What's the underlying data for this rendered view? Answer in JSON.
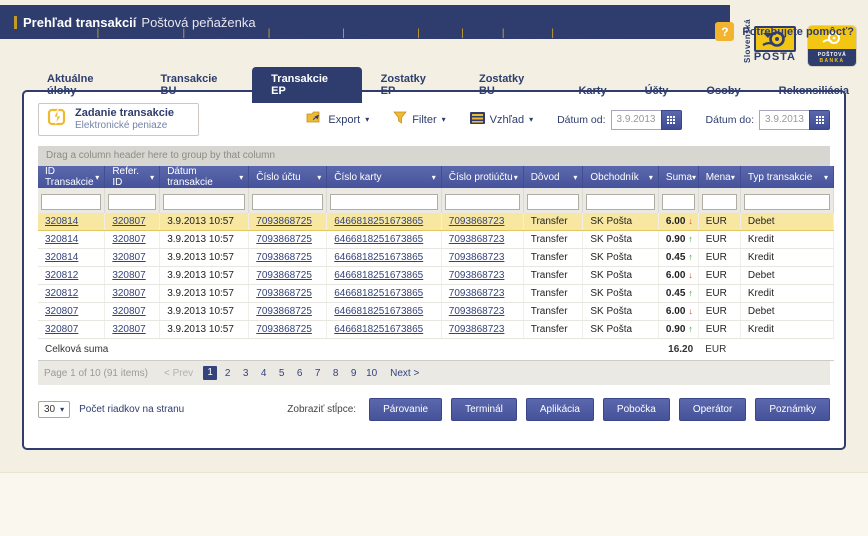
{
  "colors": {
    "navy": "#2e3d6e",
    "header_blue": "#4d5aa0",
    "gold": "#efb932",
    "logo_yellow": "#f3c613",
    "page_bg": "#f3efe2",
    "highlight_row": "#f7e7a0",
    "positive": "#2ca02c",
    "negative": "#e0482e"
  },
  "header": {
    "title": "Prehľad transakcií",
    "subtitle": "Poštová peňaženka",
    "logo_posta": {
      "vertical": "Slovenská",
      "name": "POŠTA"
    },
    "logo_banka": {
      "line1": "POŠTOVÁ",
      "line2": "BANKA"
    }
  },
  "tabs": [
    {
      "label": "Aktuálne úlohy",
      "active": false
    },
    {
      "label": "Transakcie BU",
      "active": false
    },
    {
      "label": "Transakcie EP",
      "active": true
    },
    {
      "label": "Zostatky EP",
      "active": false
    },
    {
      "label": "Zostatky BU",
      "active": false
    },
    {
      "label": "Karty",
      "active": false
    },
    {
      "label": "Účty",
      "active": false
    },
    {
      "label": "Osoby",
      "active": false
    },
    {
      "label": "Rekonsiliácia",
      "active": false
    }
  ],
  "toolbar": {
    "new_transaction": {
      "title": "Zadanie transakcie",
      "subtitle": "Elektronické peniaze",
      "icon": "lightning-icon"
    },
    "export_label": "Export",
    "filter_label": "Filter",
    "view_label": "Vzhľad",
    "date_from_label": "Dátum od:",
    "date_from_value": "3.9.2013",
    "date_to_label": "Dátum do:",
    "date_to_value": "3.9.2013",
    "icons": {
      "export": "folder-export-icon",
      "filter": "funnel-icon",
      "view": "list-icon",
      "calendar": "calendar-grid-icon"
    }
  },
  "table": {
    "group_hint": "Drag a column header here to group by that column",
    "columns": [
      "ID Transakcie",
      "Refer. ID",
      "Dátum transakcie",
      "Číslo účtu",
      "Číslo karty",
      "Číslo protiúčtu",
      "Dôvod",
      "Obchodník",
      "Suma",
      "Mena",
      "Typ transakcie"
    ],
    "rows": [
      {
        "id": "320814",
        "ref": "320807",
        "date": "3.9.2013 10:57",
        "account": "7093868725",
        "card": "6466818251673865",
        "counter": "7093868723",
        "reason": "Transfer",
        "merchant": "SK Pošta",
        "amount": "6.00",
        "direction": "down",
        "currency": "EUR",
        "type": "Debet",
        "highlight": true
      },
      {
        "id": "320814",
        "ref": "320807",
        "date": "3.9.2013 10:57",
        "account": "7093868725",
        "card": "6466818251673865",
        "counter": "7093868723",
        "reason": "Transfer",
        "merchant": "SK Pošta",
        "amount": "0.90",
        "direction": "up",
        "currency": "EUR",
        "type": "Kredit",
        "highlight": false
      },
      {
        "id": "320814",
        "ref": "320807",
        "date": "3.9.2013 10:57",
        "account": "7093868725",
        "card": "6466818251673865",
        "counter": "7093868723",
        "reason": "Transfer",
        "merchant": "SK Pošta",
        "amount": "0.45",
        "direction": "up",
        "currency": "EUR",
        "type": "Kredit",
        "highlight": false
      },
      {
        "id": "320812",
        "ref": "320807",
        "date": "3.9.2013 10:57",
        "account": "7093868725",
        "card": "6466818251673865",
        "counter": "7093868723",
        "reason": "Transfer",
        "merchant": "SK Pošta",
        "amount": "6.00",
        "direction": "down",
        "currency": "EUR",
        "type": "Debet",
        "highlight": false
      },
      {
        "id": "320812",
        "ref": "320807",
        "date": "3.9.2013 10:57",
        "account": "7093868725",
        "card": "6466818251673865",
        "counter": "7093868723",
        "reason": "Transfer",
        "merchant": "SK Pošta",
        "amount": "0.45",
        "direction": "up",
        "currency": "EUR",
        "type": "Kredit",
        "highlight": false
      },
      {
        "id": "320807",
        "ref": "320807",
        "date": "3.9.2013 10:57",
        "account": "7093868725",
        "card": "6466818251673865",
        "counter": "7093868723",
        "reason": "Transfer",
        "merchant": "SK Pošta",
        "amount": "6.00",
        "direction": "down",
        "currency": "EUR",
        "type": "Debet",
        "highlight": false
      },
      {
        "id": "320807",
        "ref": "320807",
        "date": "3.9.2013 10:57",
        "account": "7093868725",
        "card": "6466818251673865",
        "counter": "7093868723",
        "reason": "Transfer",
        "merchant": "SK Pošta",
        "amount": "0.90",
        "direction": "up",
        "currency": "EUR",
        "type": "Kredit",
        "highlight": false
      }
    ],
    "total_label": "Celková suma",
    "total_amount": "16.20",
    "total_currency": "EUR"
  },
  "pagination": {
    "info": "Page 1 of 10 (91 items)",
    "prev_label": "< Prev",
    "pages": [
      "1",
      "2",
      "3",
      "4",
      "5",
      "6",
      "7",
      "8",
      "9",
      "10"
    ],
    "current_page": "1",
    "next_label": "Next >"
  },
  "footer_controls": {
    "page_size_value": "30",
    "page_size_label": "Počet riadkov na stranu",
    "show_columns_label": "Zobraziť stĺpce:",
    "column_buttons": [
      "Párovanie",
      "Terminál",
      "Aplikácia",
      "Pobočka",
      "Operátor",
      "Poznámky"
    ]
  },
  "footer": {
    "links": [
      "Aktuálne úlohy",
      "Transakcie BU",
      "Transakcie EP",
      "Zostatky EP",
      "Zostatky BU",
      "Karty",
      "Účty",
      "Osoby",
      "Rekonsiliácia"
    ],
    "help_label": "Potrebujete pomôcť?",
    "help_icon": "question-mark-icon"
  }
}
